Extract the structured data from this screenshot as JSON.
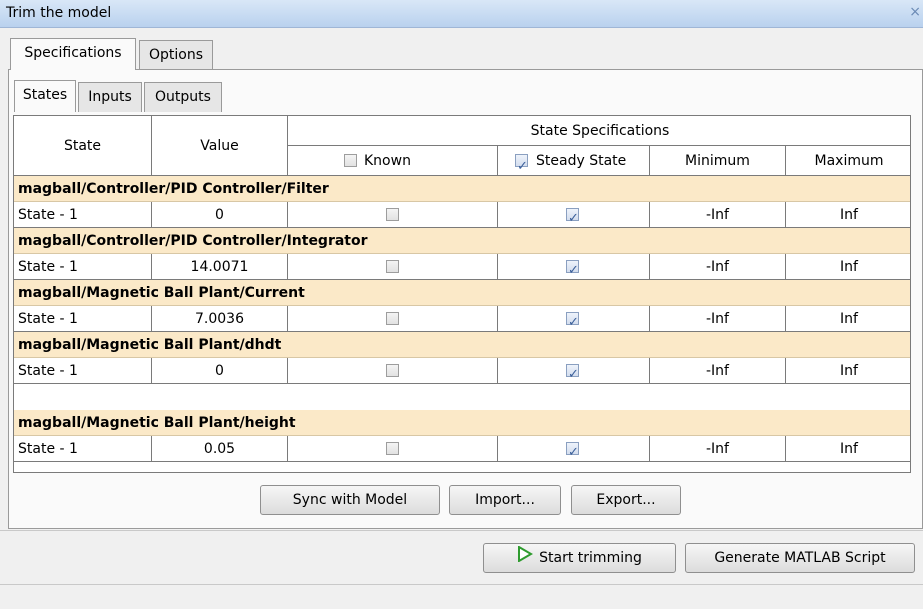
{
  "window": {
    "title": "Trim the model",
    "close_glyph": "×"
  },
  "main_tabs": [
    {
      "label": "Specifications",
      "active": true
    },
    {
      "label": "Options",
      "active": false
    }
  ],
  "sub_tabs": [
    {
      "label": "States",
      "active": true
    },
    {
      "label": "Inputs",
      "active": false
    },
    {
      "label": "Outputs",
      "active": false
    }
  ],
  "table": {
    "headers": {
      "state": "State",
      "value": "Value",
      "specs": "State Specifications",
      "known": "Known",
      "steady": "Steady State",
      "minimum": "Minimum",
      "maximum": "Maximum"
    },
    "known_header_checked": false,
    "steady_header_checked": true,
    "groups": [
      {
        "name": "magball/Controller/PID Controller/Filter",
        "rows": [
          {
            "state": "State - 1",
            "value": "0",
            "known": false,
            "steady": true,
            "minimum": "-Inf",
            "maximum": "Inf"
          }
        ]
      },
      {
        "name": "magball/Controller/PID Controller/Integrator",
        "rows": [
          {
            "state": "State - 1",
            "value": "14.0071",
            "known": false,
            "steady": true,
            "minimum": "-Inf",
            "maximum": "Inf"
          }
        ]
      },
      {
        "name": "magball/Magnetic Ball Plant/Current",
        "rows": [
          {
            "state": "State - 1",
            "value": "7.0036",
            "known": false,
            "steady": true,
            "minimum": "-Inf",
            "maximum": "Inf"
          }
        ]
      },
      {
        "name": "magball/Magnetic Ball Plant/dhdt",
        "rows": [
          {
            "state": "State - 1",
            "value": "0",
            "known": false,
            "steady": true,
            "minimum": "-Inf",
            "maximum": "Inf"
          }
        ]
      },
      {
        "name": "magball/Magnetic Ball Plant/height",
        "rows": [
          {
            "state": "State - 1",
            "value": "0.05",
            "known": false,
            "steady": true,
            "minimum": "-Inf",
            "maximum": "Inf"
          }
        ]
      }
    ]
  },
  "buttons": {
    "sync": "Sync with Model",
    "import": "Import...",
    "export": "Export...",
    "start": "Start trimming",
    "generate": "Generate MATLAB Script"
  },
  "colors": {
    "group_row": "#fbe9c8",
    "play_icon": "#2e9b2e",
    "check_mark": "#3b5f9a"
  },
  "icons": {
    "start": "play-icon"
  }
}
